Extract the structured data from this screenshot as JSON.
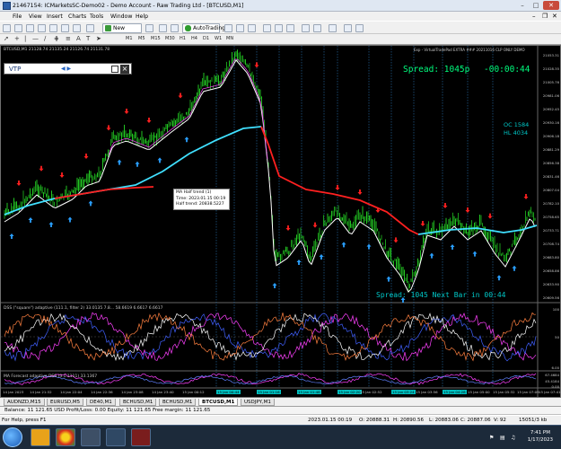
{
  "window": {
    "title": "21467154: ICMarketsSC-Demo02 - Demo Account - Raw Trading Ltd - [BTCUSD,M1]"
  },
  "menu": {
    "items": [
      "File",
      "View",
      "Insert",
      "Charts",
      "Tools",
      "Window",
      "Help"
    ]
  },
  "toolbar": {
    "new_order": "New Order",
    "autotrading": "AutoTrading",
    "timeframes": [
      "M1",
      "M5",
      "M15",
      "M30",
      "H1",
      "H4",
      "D1",
      "W1",
      "MN"
    ]
  },
  "chart": {
    "symbol_line": "BTCUSD,M1  21128.74 21135.24 21126.74 21131.78",
    "top_right_label": "Exp - VirtualTradePad EXTRA ### 20211016 CLP ONLY DEMO",
    "spread": "Spread: 1045p",
    "countdown": "-00:00:44",
    "oc": "OC 1584",
    "hl": "HL 4034",
    "spread_bar": "Spread: 1045 Next Bar in 00:44",
    "vtp_label": "VTP",
    "tooltip": [
      "MA Half trend (1)",
      "Time: 2023.01.15 00:19",
      "Half trend: 20838.5227"
    ],
    "dss_label": "DSS (\"square\") adaptive (111.1, filter 2) 33.0135 7.8... 58.6619 6.6617 6.6617",
    "mfi_label": "MA Forecast adaptive DSS (3.1.1111) 33.1367",
    "price_labels": [
      "21053.31",
      "21028.35",
      "21005.76",
      "20981.06",
      "20952.45",
      "20930.16",
      "20906.18",
      "20881.29",
      "20856.38",
      "20831.46",
      "20807.04",
      "20782.10",
      "20758.65",
      "20733.71",
      "20708.74",
      "20683.80",
      "20658.86",
      "20633.90",
      "20609.56"
    ],
    "dss_scale": [
      "100",
      "50",
      "6.00"
    ],
    "mfi_scale": [
      "67.4684",
      "45.4184",
      "0.00"
    ],
    "time_labels": [
      "14 Jan 2023",
      "14 Jan 21:32",
      "14 Jan 22:04",
      "14 Jan 22:36",
      "14 Jan 23:08",
      "14 Jan 23:40",
      "15 Jan 00:12",
      "15 Jan 00:44",
      "15 Jan 01:16",
      "15 Jan 01:48",
      "15 Jan 02:20",
      "15 Jan 02:52",
      "15 Jan 03:24",
      "15 Jan 03:56",
      "15 Jan 04:28",
      "15 Jan 05:00",
      "15 Jan 05:32",
      "15 Jan 06:04",
      "15 Jan 06:36",
      "15 Jan 07:09",
      "15 Jan 07:41"
    ]
  },
  "symbol_tabs": [
    "AUDNZD,M15",
    "EURUSD,M5",
    "DE40,M1",
    "BCHUSD,M1",
    "BCHUSD,M1",
    "BTCUSD,M1",
    "USDJPY,M1"
  ],
  "active_tab": "BTCUSD,M1",
  "account": {
    "text": "Balance: 11 121.65 USD  Profit/Loss: 0.00  Equity: 11 121.65  Free margin: 11 121.65"
  },
  "status": {
    "help": "For Help, press F1",
    "datetime": "2023.01.15 00:19",
    "open": "O: 20888.31",
    "high": "H: 20890.56",
    "low": "L: 20883.06",
    "close": "C: 20887.06",
    "volume": "V: 92",
    "traffic": "15051/3 kb"
  },
  "taskbar": {
    "time": "7:41 PM",
    "date": "1/17/2023"
  },
  "colors": {
    "accent_green": "#00ff7f",
    "ma_cyan": "#40e0ff",
    "ma_red": "#ff2020",
    "ma_white": "#ffffff",
    "ma_magenta": "#e040e0"
  }
}
